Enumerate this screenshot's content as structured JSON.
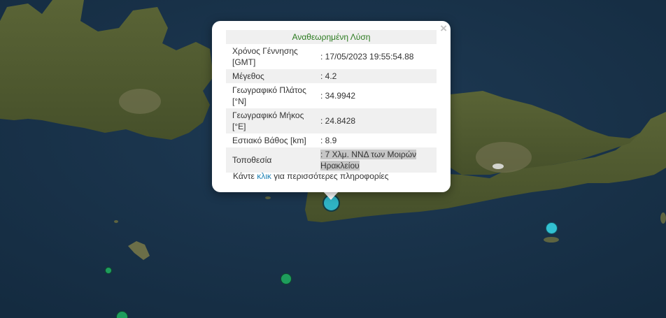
{
  "popup": {
    "title": "Αναθεωρημένη Λύση",
    "close_symbol": "×",
    "rows": [
      {
        "key": "Χρόνος Γέννησης [GMT]",
        "value": ": 17/05/2023 19:55:54.88"
      },
      {
        "key": "Μέγεθος",
        "value": ": 4.2"
      },
      {
        "key": "Γεωγραφικό Πλάτος [°N]",
        "value": ": 34.9942"
      },
      {
        "key": "Γεωγραφικό Μήκος [°E]",
        "value": ": 24.8428"
      },
      {
        "key": "Εστιακό Βάθος [km]",
        "value": ": 8.9"
      },
      {
        "key": "Τοποθεσία",
        "value": ": 7 Χλμ. ΝΝΔ των Μοιρών Ηρακλείου"
      }
    ],
    "more_prefix": "Κάντε ",
    "more_link": "κλικ",
    "more_suffix": " για περισσότερες πληροφορίες"
  },
  "colors": {
    "sea": "#17324a",
    "land": "#4f5a30",
    "marker_selected": "#2fb3c4",
    "marker_cyan": "#32c1d2",
    "marker_green": "#1e9d5c",
    "popup_title": "#2a7a1e",
    "link": "#1e82b4"
  },
  "markers": [
    {
      "name": "selected-earthquake-marker",
      "color": "marker_selected"
    },
    {
      "name": "earthquake-marker-east",
      "color": "marker_cyan"
    },
    {
      "name": "earthquake-marker-south",
      "color": "marker_green"
    },
    {
      "name": "earthquake-marker-southwest",
      "color": "marker_green"
    },
    {
      "name": "earthquake-marker-bottom",
      "color": "marker_green"
    }
  ]
}
